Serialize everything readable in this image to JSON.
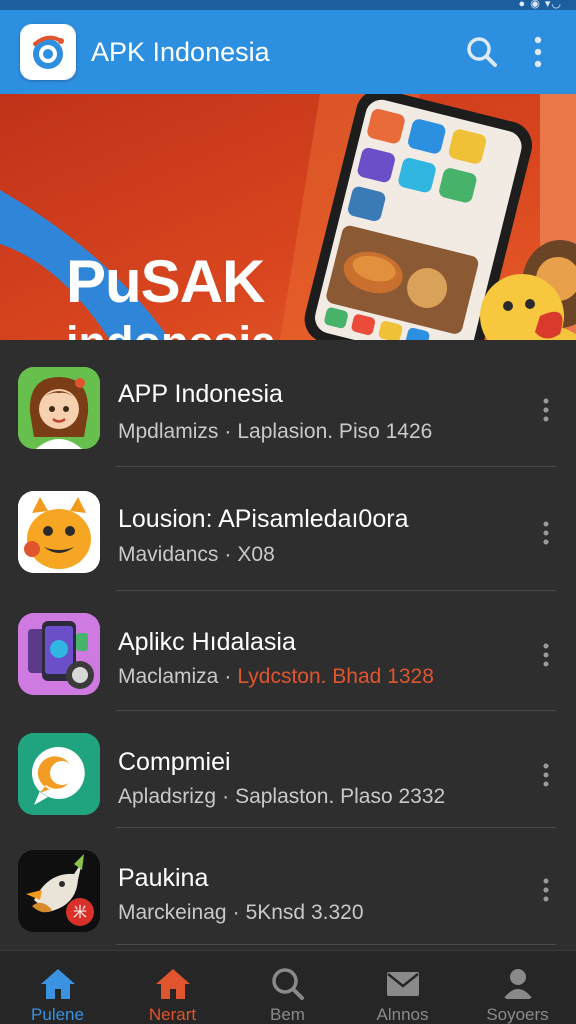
{
  "status_bar": {
    "right_text": "● ◉ ▾◡"
  },
  "app_bar": {
    "title": "APK Indonesia",
    "logo_icon": "app-logo-icon",
    "search_icon": "search-icon",
    "more_icon": "more-vertical-icon"
  },
  "banner": {
    "line1": "PuSAK",
    "line2": "indonesia"
  },
  "apps": [
    {
      "title": "APP Indonesia",
      "sub_left": "Mpdlamizs",
      "sub_right": "Laplasion. Piso 1426",
      "sub_right_accent": false,
      "icon": "girl-avatar-icon"
    },
    {
      "title": "Lousion: APisamledaı0ora",
      "sub_left": "Mavidancs",
      "sub_right": "X08",
      "sub_right_accent": false,
      "icon": "orange-monster-icon"
    },
    {
      "title": "Aplikc Hıdalasia",
      "sub_left": "Maclamiza",
      "sub_right": "Lydcston. Bhad 1328",
      "sub_right_accent": true,
      "icon": "phone-gadget-icon"
    },
    {
      "title": "Compmiei",
      "sub_left": "Apladsrizg",
      "sub_right": "Saplaston. Plaso 2332",
      "sub_right_accent": false,
      "icon": "chat-bubble-icon"
    },
    {
      "title": "Paukina",
      "sub_left": "Marckeinag",
      "sub_right": "5Knsd 3.320",
      "sub_right_accent": false,
      "icon": "bird-icon"
    }
  ],
  "bottom_nav": [
    {
      "label": "Pulene",
      "icon": "home-icon"
    },
    {
      "label": "Nerart",
      "icon": "home-icon"
    },
    {
      "label": "Bem",
      "icon": "search-icon"
    },
    {
      "label": "Alnnos",
      "icon": "mail-icon"
    },
    {
      "label": "Soyoers",
      "icon": "user-icon"
    }
  ],
  "colors": {
    "app_bar": "#2d8fe0",
    "banner_red": "#d63a1f",
    "accent_orange": "#e0552e",
    "accent_blue": "#3a92e0",
    "list_bg": "#2e2e2e"
  }
}
